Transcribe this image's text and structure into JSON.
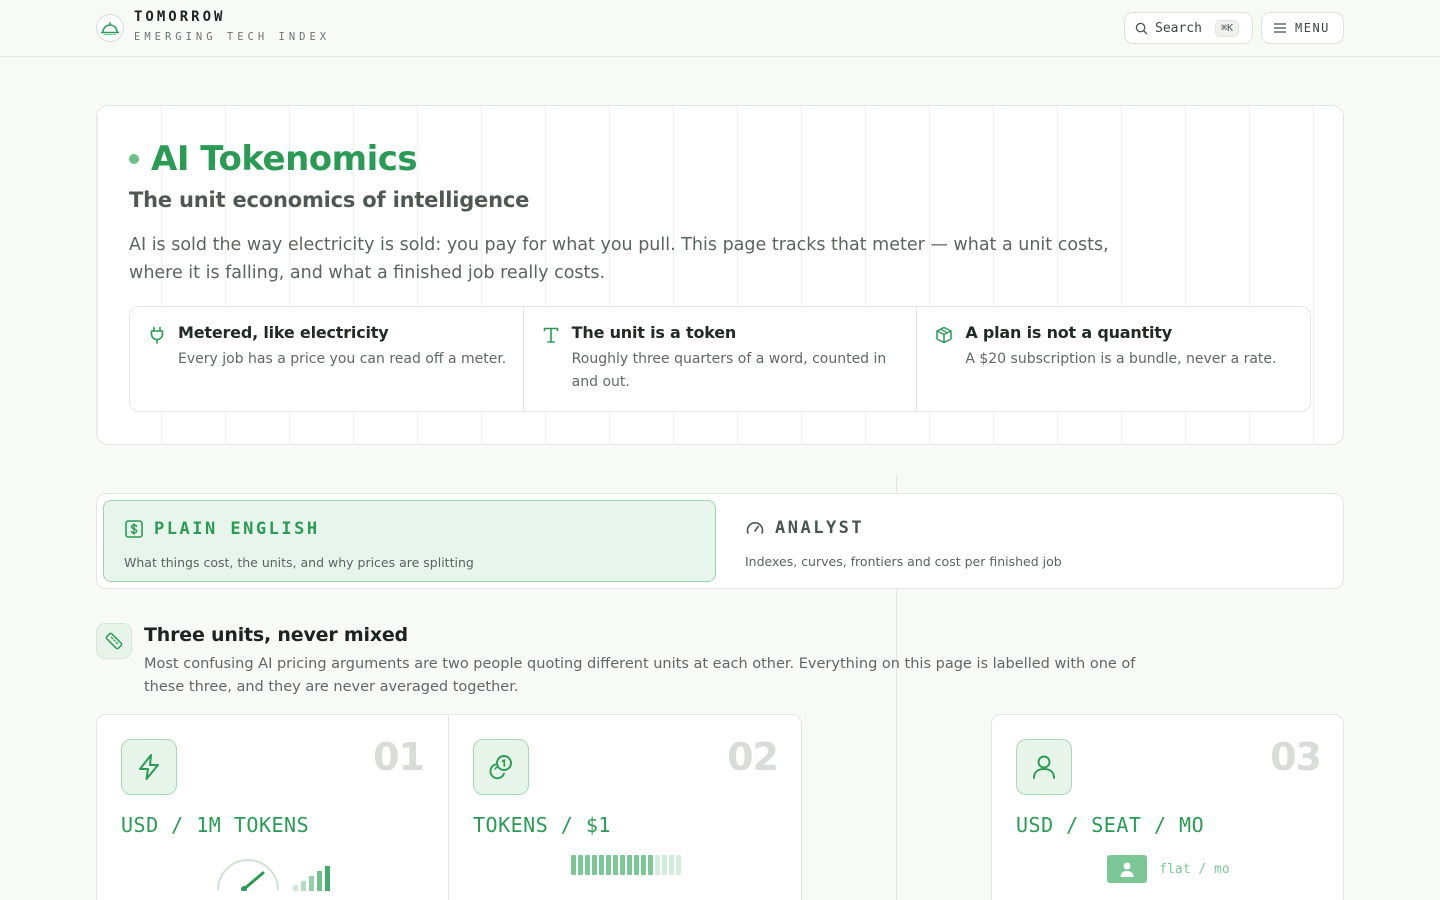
{
  "header": {
    "brand": "TOMORROW",
    "tagline": "EMERGING TECH INDEX",
    "search_label": "Search",
    "search_shortcut": "⌘K",
    "menu_label": "MENU"
  },
  "hero": {
    "title": "AI Tokenomics",
    "subtitle": "The unit economics of intelligence",
    "description": "AI is sold the way electricity is sold: you pay for what you pull. This page tracks that meter — what a unit costs, where it is falling, and what a finished job really costs.",
    "facts": [
      {
        "icon": "plug-icon",
        "title": "Metered, like electricity",
        "body": "Every job has a price you can read off a meter."
      },
      {
        "icon": "type-icon",
        "title": "The unit is a token",
        "body": "Roughly three quarters of a word, counted in and out."
      },
      {
        "icon": "box-icon",
        "title": "A plan is not a quantity",
        "body": "A $20 subscription is a bundle, never a rate."
      }
    ]
  },
  "modes": [
    {
      "label": "PLAIN ENGLISH",
      "description": "What things cost, the units, and why prices are splitting",
      "active": true,
      "icon": "dollar-square-icon"
    },
    {
      "label": "ANALYST",
      "description": "Indexes, curves, frontiers and cost per finished job",
      "active": false,
      "icon": "gauge-icon"
    }
  ],
  "section": {
    "title": "Three units, never mixed",
    "description": "Most confusing AI pricing arguments are two people quoting different units at each other. Everything on this page is labelled with one of these three, and they are never averaged together."
  },
  "units": [
    {
      "number": "01",
      "label": "USD / 1M TOKENS",
      "icon": "bolt-icon",
      "visual": "gauge-and-signal"
    },
    {
      "number": "02",
      "label": "TOKENS / $1",
      "icon": "coins-icon",
      "visual": "segment-bar",
      "filled_fraction": 0.72
    },
    {
      "number": "03",
      "label": "USD / SEAT / MO",
      "icon": "user-icon",
      "visual": "flat",
      "visual_caption": "flat / mo"
    }
  ],
  "colors": {
    "accent": "#2a9b54",
    "accent_light": "#7cc796",
    "background": "#f8faf6",
    "border": "#e2e7e1"
  }
}
